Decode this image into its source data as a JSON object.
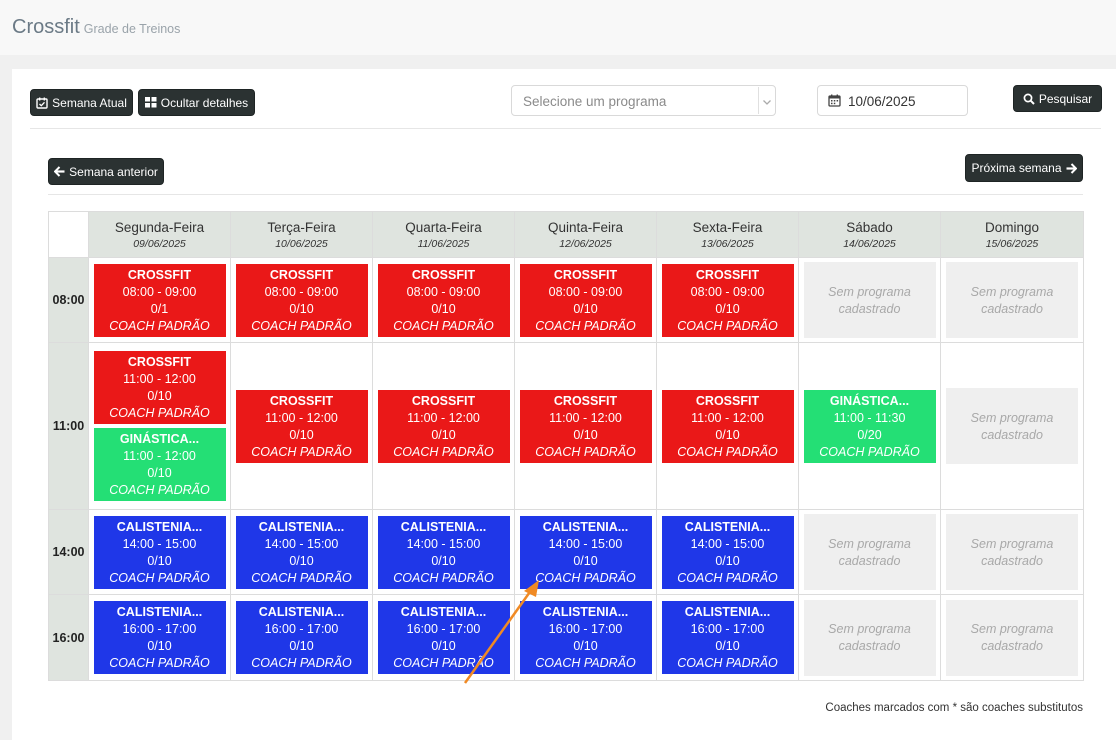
{
  "header": {
    "title": "Crossfit",
    "subtitle": "Grade de Treinos"
  },
  "toolbar": {
    "current_week": "Semana Atual",
    "hide_details": "Ocultar detalhes",
    "program_placeholder": "Selecione um programa",
    "date_value": "10/06/2025",
    "search": "Pesquisar"
  },
  "nav": {
    "prev_week": "Semana anterior",
    "next_week": "Próxima semana"
  },
  "days": [
    {
      "name": "Segunda-Feira",
      "date": "09/06/2025"
    },
    {
      "name": "Terça-Feira",
      "date": "10/06/2025"
    },
    {
      "name": "Quarta-Feira",
      "date": "11/06/2025"
    },
    {
      "name": "Quinta-Feira",
      "date": "12/06/2025"
    },
    {
      "name": "Sexta-Feira",
      "date": "13/06/2025"
    },
    {
      "name": "Sábado",
      "date": "14/06/2025"
    },
    {
      "name": "Domingo",
      "date": "15/06/2025"
    }
  ],
  "empty_label": {
    "line1": "Sem programa",
    "line2": "cadastrado"
  },
  "rows": [
    {
      "time": "08:00",
      "cells": [
        [
          {
            "name": "CROSSFIT",
            "time": "08:00 - 09:00",
            "count": "0/1",
            "coach": "COACH PADRÃO",
            "color": "red"
          }
        ],
        [
          {
            "name": "CROSSFIT",
            "time": "08:00 - 09:00",
            "count": "0/10",
            "coach": "COACH PADRÃO",
            "color": "red"
          }
        ],
        [
          {
            "name": "CROSSFIT",
            "time": "08:00 - 09:00",
            "count": "0/10",
            "coach": "COACH PADRÃO",
            "color": "red"
          }
        ],
        [
          {
            "name": "CROSSFIT",
            "time": "08:00 - 09:00",
            "count": "0/10",
            "coach": "COACH PADRÃO",
            "color": "red"
          }
        ],
        [
          {
            "name": "CROSSFIT",
            "time": "08:00 - 09:00",
            "count": "0/10",
            "coach": "COACH PADRÃO",
            "color": "red"
          }
        ],
        [
          {
            "empty": true
          }
        ],
        [
          {
            "empty": true
          }
        ]
      ]
    },
    {
      "time": "11:00",
      "cells": [
        [
          {
            "name": "CROSSFIT",
            "time": "11:00 - 12:00",
            "count": "0/10",
            "coach": "COACH PADRÃO",
            "color": "red"
          },
          {
            "name": "GINÁSTICA...",
            "time": "11:00 - 12:00",
            "count": "0/10",
            "coach": "COACH PADRÃO",
            "color": "green"
          }
        ],
        [
          {
            "name": "CROSSFIT",
            "time": "11:00 - 12:00",
            "count": "0/10",
            "coach": "COACH PADRÃO",
            "color": "red"
          }
        ],
        [
          {
            "name": "CROSSFIT",
            "time": "11:00 - 12:00",
            "count": "0/10",
            "coach": "COACH PADRÃO",
            "color": "red"
          }
        ],
        [
          {
            "name": "CROSSFIT",
            "time": "11:00 - 12:00",
            "count": "0/10",
            "coach": "COACH PADRÃO",
            "color": "red"
          }
        ],
        [
          {
            "name": "CROSSFIT",
            "time": "11:00 - 12:00",
            "count": "0/10",
            "coach": "COACH PADRÃO",
            "color": "red"
          }
        ],
        [
          {
            "name": "GINÁSTICA...",
            "time": "11:00 - 11:30",
            "count": "0/20",
            "coach": "COACH PADRÃO",
            "color": "green"
          }
        ],
        [
          {
            "empty": true
          }
        ]
      ]
    },
    {
      "time": "14:00",
      "cells": [
        [
          {
            "name": "CALISTENIA...",
            "time": "14:00 - 15:00",
            "count": "0/10",
            "coach": "COACH PADRÃO",
            "color": "blue"
          }
        ],
        [
          {
            "name": "CALISTENIA...",
            "time": "14:00 - 15:00",
            "count": "0/10",
            "coach": "COACH PADRÃO",
            "color": "blue"
          }
        ],
        [
          {
            "name": "CALISTENIA...",
            "time": "14:00 - 15:00",
            "count": "0/10",
            "coach": "COACH PADRÃO",
            "color": "blue"
          }
        ],
        [
          {
            "name": "CALISTENIA...",
            "time": "14:00 - 15:00",
            "count": "0/10",
            "coach": "COACH PADRÃO",
            "color": "blue"
          }
        ],
        [
          {
            "name": "CALISTENIA...",
            "time": "14:00 - 15:00",
            "count": "0/10",
            "coach": "COACH PADRÃO",
            "color": "blue"
          }
        ],
        [
          {
            "empty": true
          }
        ],
        [
          {
            "empty": true
          }
        ]
      ]
    },
    {
      "time": "16:00",
      "cells": [
        [
          {
            "name": "CALISTENIA...",
            "time": "16:00 - 17:00",
            "count": "0/10",
            "coach": "COACH PADRÃO",
            "color": "blue"
          }
        ],
        [
          {
            "name": "CALISTENIA...",
            "time": "16:00 - 17:00",
            "count": "0/10",
            "coach": "COACH PADRÃO",
            "color": "blue"
          }
        ],
        [
          {
            "name": "CALISTENIA...",
            "time": "16:00 - 17:00",
            "count": "0/10",
            "coach": "COACH PADRÃO",
            "color": "blue"
          }
        ],
        [
          {
            "name": "CALISTENIA...",
            "time": "16:00 - 17:00",
            "count": "0/10",
            "coach": "COACH PADRÃO",
            "color": "blue"
          }
        ],
        [
          {
            "name": "CALISTENIA...",
            "time": "16:00 - 17:00",
            "count": "0/10",
            "coach": "COACH PADRÃO",
            "color": "blue"
          }
        ],
        [
          {
            "empty": true
          }
        ],
        [
          {
            "empty": true
          }
        ]
      ]
    }
  ],
  "footnote": "Coaches marcados com * são coaches substitutos",
  "colors": {
    "red": "#ea1818",
    "blue": "#1f37e8",
    "green": "#24df75",
    "button_dark": "#2b3232",
    "annotation_arrow": "#f08a24"
  },
  "icons": {
    "current_week": "calendar-check-icon",
    "hide_details": "grid-icon",
    "select": "chevron-down-icon",
    "date": "calendar-icon",
    "search": "search-icon",
    "prev": "arrow-left-icon",
    "next": "arrow-right-icon"
  }
}
